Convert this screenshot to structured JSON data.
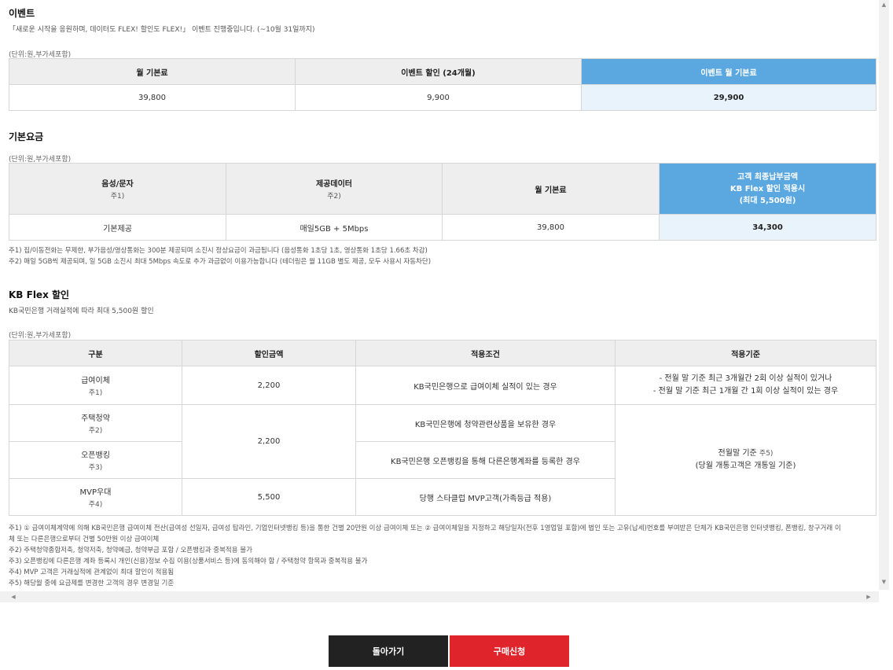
{
  "event": {
    "title": "이벤트",
    "desc": "「새로운 시작을 응원하며, 데이터도 FLEX! 할인도 FLEX!」 이벤트 진행중입니다. (~10월 31일까지)",
    "unit": "(단위:원,부가세포함)",
    "headers": [
      "월 기본료",
      "이벤트 할인 (24개월)",
      "이벤트 월 기본료"
    ],
    "values": [
      "39,800",
      "9,900",
      "29,900"
    ]
  },
  "basic": {
    "title": "기본요금",
    "unit": "(단위:원,부가세포함)",
    "headers": [
      {
        "label": "음성/문자",
        "sub": "주1)"
      },
      {
        "label": "제공데이터",
        "sub": "주2)"
      },
      {
        "label": "월 기본료",
        "sub": ""
      },
      {
        "label1": "고객 최종납부금액",
        "label2": "KB Flex 할인 적용시",
        "label3": "(최대 5,500원)"
      }
    ],
    "values": [
      "기본제공",
      "매일5GB + 5Mbps",
      "39,800",
      "34,300"
    ],
    "notes": [
      "주1) 집/이동전화는 무제한, 부가음성/영상통화는 300분 제공되며 소진시 정상요금이 과금됩니다 (음성통화 1초당 1초, 영상통화 1초당 1.66초 차감)",
      "주2) 매일 5GB씩 제공되며, 일 5GB 소진시 최대 5Mbps 속도로 추가 과금없이 이용가능합니다 (테더링은 월 11GB 별도 제공, 모두 사용시 자동차단)"
    ]
  },
  "kbflex": {
    "title": "KB Flex 할인",
    "desc": "KB국민은행 거래실적에 따라 최대 5,500원 할인",
    "unit": "(단위:원,부가세포함)",
    "headers": [
      "구분",
      "할인금액",
      "적용조건",
      "적용기준"
    ],
    "rows": [
      {
        "name": "급여이체",
        "sub": "주1)",
        "amount": "2,200",
        "cond": "KB국민은행으로 급여이체 실적이 있는 경우",
        "crit1": "- 전월 말 기준 최근 3개월간 2회 이상 실적이 있거나",
        "crit2": "- 전월 말 기준 최근 1개월 간 1회 이상 실적이 있는 경우"
      },
      {
        "name": "주택청약",
        "sub": "주2)",
        "amount": "2,200",
        "cond": "KB국민은행에 청약관련상품을 보유한 경우",
        "crit1": "전월말 기준",
        "crit1sub": "주5)",
        "crit2": "(당월 개통고객은 개통일 기준)"
      },
      {
        "name": "오픈뱅킹",
        "sub": "주3)",
        "cond": "KB국민은행 오픈뱅킹을 통해 다른은행계좌를 등록한 경우"
      },
      {
        "name": "MVP우대",
        "sub": "주4)",
        "amount": "5,500",
        "cond": "당행 스타클럽 MVP고객(가족등급 적용)"
      }
    ],
    "notes": [
      "주1) ① 급여이체계약에 의해 KB국민은행 급여이체 전산(급여성 선일자, 급여성 탑라인, 기업인터넷뱅킹 등)을 통한 건별 20만원 이상 급여이체 또는 ② 급여이체일을 지정하고 해당일자(전후 1영업일 포함)에 법인 또는 고유(납세)번호를 부여받은 단체가 KB국민은행 인터넷뱅킹, 폰뱅킹, 창구거래 이",
      "체 또는 다른은행으로부터 건별 50만원 이상 급여이체",
      "주2) 주택청약종합저축, 청약저축, 청약예금, 청약부금 포함 / 오픈뱅킹과 중복적용 불가",
      "주3) 오픈뱅킹에 다른은행 계좌 등록시 개인(신용)정보 수집 이용(상품서비스 등)에 동의해야 함 / 주택청약 항목과 중복적용 불가",
      "주4) MVP 고객은 거래실적에 관계없이 최대 할인이 적용됨",
      "주5) 해당월 중에 요금제를 변경한 고객의 경우 변경일 기준"
    ]
  },
  "buttons": {
    "back": "돌아가기",
    "buy": "구매신청"
  },
  "scroll": {
    "up": "▲",
    "down": "▼",
    "left": "◀",
    "right": "▶"
  }
}
